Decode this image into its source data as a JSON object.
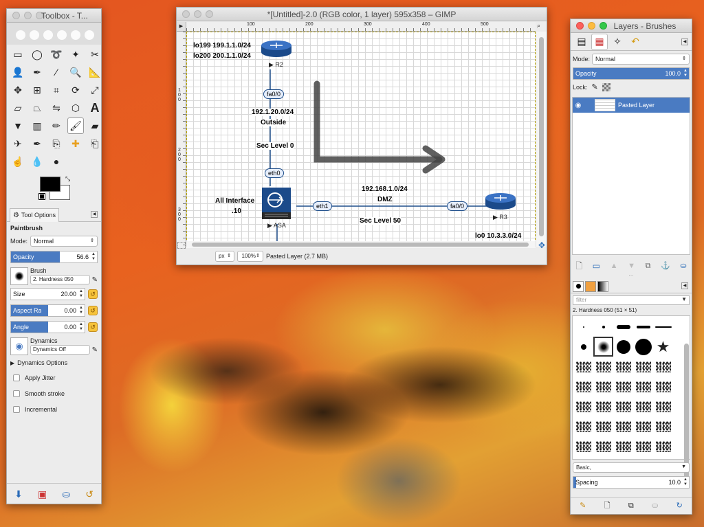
{
  "toolbox": {
    "title": "Toolbox - T...",
    "tool_icons": [
      "rect-select-icon",
      "ellipse-select-icon",
      "free-select-icon",
      "fuzzy-select-icon",
      "scissors-select-icon",
      "foreground-select-icon",
      "paths-icon",
      "color-picker-icon",
      "zoom-icon",
      "measure-icon",
      "move-icon",
      "align-icon",
      "crop-icon",
      "rotate-icon",
      "scale-icon",
      "shear-icon",
      "perspective-icon",
      "flip-icon",
      "cage-icon",
      "text-icon",
      "bucket-fill-icon",
      "blend-icon",
      "pencil-icon",
      "paintbrush-icon",
      "eraser-icon",
      "airbrush-icon",
      "ink-icon",
      "clone-icon",
      "heal-icon",
      "perspective-clone-icon",
      "smudge-icon",
      "blur-icon",
      "dodge-icon"
    ],
    "fg_color": "#000000",
    "bg_color": "#ffffff",
    "tab_label": "Tool Options",
    "tool_name": "Paintbrush",
    "mode_label": "Mode:",
    "mode_value": "Normal",
    "opacity_label": "Opacity",
    "opacity_value": "56.6",
    "opacity_fraction": 0.566,
    "brush_label": "Brush",
    "brush_value": "2. Hardness 050",
    "size_label": "Size",
    "size_value": "20.00",
    "aspect_label": "Aspect Ratio",
    "aspect_value": "0.00",
    "angle_label": "Angle",
    "angle_value": "0.00",
    "dynamics_label": "Dynamics",
    "dynamics_value": "Dynamics Off",
    "dynamics_options": "Dynamics Options",
    "apply_jitter": "Apply Jitter",
    "smooth_stroke": "Smooth stroke",
    "incremental": "Incremental"
  },
  "gimp": {
    "title": "*[Untitled]-2.0 (RGB color, 1 layer) 595x358 – GIMP",
    "ruler_top": [
      "100",
      "200",
      "300",
      "400",
      "500"
    ],
    "ruler_left": [
      "100",
      "200",
      "300"
    ],
    "unit": "px",
    "zoom": "100%",
    "status": "Pasted Layer (2.7 MB)",
    "diagram": {
      "r2_lo199": "lo199 199.1.1.0/24",
      "r2_lo200": "lo200 200.1.1.0/24",
      "r2_label": "▶ R2",
      "r2_if": "fa0/0",
      "outside_net": "192.1.20.0/24",
      "outside_name": "Outside",
      "outside_sec": "Sec Level 0",
      "asa_if_out": "eth0",
      "all_interface": "All Interface",
      "all_interface_ip": ".10",
      "asa_label": "▶ ASA",
      "asa_if_dmz": "eth1",
      "dmz_net": "192.168.1.0/24",
      "dmz_name": "DMZ",
      "dmz_sec": "Sec Level 50",
      "r3_if": "fa0/0",
      "r3_label": "▶ R3",
      "r3_lo0": "lo0 10.3.3.0/24"
    }
  },
  "layers": {
    "title": "Layers - Brushes",
    "mode_label": "Mode:",
    "mode_value": "Normal",
    "opacity_label": "Opacity",
    "opacity_value": "100.0",
    "lock_label": "Lock:",
    "layer_name": "Pasted Layer",
    "filter_placeholder": "filter",
    "brush_info": "2. Hardness 050 (51 × 51)",
    "brush_tag": "Basic,",
    "spacing_label": "Spacing",
    "spacing_value": "10.0"
  }
}
